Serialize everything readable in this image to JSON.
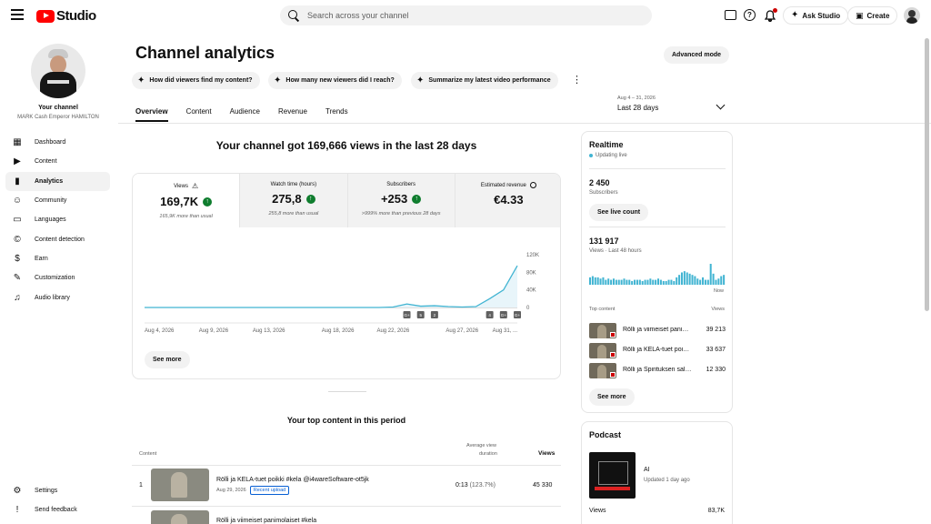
{
  "header": {
    "logo_text": "Studio",
    "search_placeholder": "Search across your channel",
    "ask_studio": "Ask Studio",
    "create": "Create",
    "icons": [
      "menu-icon",
      "messages-icon",
      "help-icon",
      "notifications-icon"
    ]
  },
  "sidebar": {
    "your_channel": "Your channel",
    "channel_name": "MARK Cash Emperor HAMILTON",
    "items": [
      {
        "label": "Dashboard",
        "icon": "dashboard-icon",
        "glyph": "▦"
      },
      {
        "label": "Content",
        "icon": "content-icon",
        "glyph": "▶"
      },
      {
        "label": "Analytics",
        "icon": "analytics-icon",
        "glyph": "▮",
        "active": true
      },
      {
        "label": "Community",
        "icon": "community-icon",
        "glyph": "☺"
      },
      {
        "label": "Languages",
        "icon": "languages-icon",
        "glyph": "▭"
      },
      {
        "label": "Content detection",
        "icon": "copyright-icon",
        "glyph": "©"
      },
      {
        "label": "Earn",
        "icon": "earn-icon",
        "glyph": "$"
      },
      {
        "label": "Customization",
        "icon": "customization-icon",
        "glyph": "✎"
      },
      {
        "label": "Audio library",
        "icon": "audio-library-icon",
        "glyph": "♫"
      }
    ],
    "bottom": [
      {
        "label": "Settings",
        "icon": "settings-icon",
        "glyph": "⚙"
      },
      {
        "label": "Send feedback",
        "icon": "feedback-icon",
        "glyph": "!"
      }
    ]
  },
  "main": {
    "title": "Channel analytics",
    "advanced_mode": "Advanced mode",
    "chips": [
      "How did viewers find my content?",
      "How many new viewers did I reach?",
      "Summarize my latest video performance"
    ],
    "tabs": [
      "Overview",
      "Content",
      "Audience",
      "Revenue",
      "Trends"
    ],
    "active_tab": "Overview",
    "date_range_sub": "Aug 4 – 31, 2026",
    "date_range": "Last 28 days",
    "headline": "Your channel got 169,666 views in the last 28 days",
    "metrics": [
      {
        "label": "Views",
        "value": "169,7K",
        "sub": "165,9K more than usual",
        "up": true,
        "icon": "warning-icon"
      },
      {
        "label": "Watch time (hours)",
        "value": "275,8",
        "sub": "255,8 more than usual",
        "up": true
      },
      {
        "label": "Subscribers",
        "value": "+253",
        "sub": ">999% more than previous 28 days",
        "up": true
      },
      {
        "label": "Estimated revenue",
        "value": "€4.33",
        "sub": "",
        "up": false,
        "icon": "clock-icon"
      }
    ],
    "see_more": "See more",
    "top_content_title": "Your top content in this period",
    "table_headers": {
      "content": "Content",
      "avg_duration_1": "Average view",
      "avg_duration_2": "duration",
      "views": "Views"
    },
    "rows": [
      {
        "num": "1",
        "title": "Rölli ja KELA-tuet poikki #kela @i4wareSoftware-ot5jk",
        "date": "Aug 29, 2026",
        "badge": "Recent upload",
        "duration": "0:13",
        "pct": "(123.7%)",
        "views": "45 330"
      },
      {
        "num": "",
        "title": "Rölli ja viimeiset panimolaiset #kela",
        "date": "",
        "badge": "",
        "duration": "",
        "pct": "",
        "views": ""
      }
    ]
  },
  "realtime": {
    "title": "Realtime",
    "updating": "Updating live",
    "subscribers": "2 450",
    "subscribers_label": "Subscribers",
    "see_live_count": "See live count",
    "views": "131 917",
    "views_label": "Views · Last 48 hours",
    "now": "Now",
    "bars": [
      6,
      7,
      6,
      6,
      5,
      6,
      4,
      5,
      4,
      5,
      4,
      4,
      4,
      5,
      4,
      4,
      3,
      4,
      4,
      4,
      3,
      4,
      4,
      5,
      4,
      4,
      5,
      4,
      3,
      3,
      4,
      4,
      3,
      6,
      8,
      10,
      11,
      10,
      9,
      8,
      7,
      5,
      4,
      6,
      4,
      4,
      17,
      9,
      4,
      5,
      7,
      8
    ],
    "top_content_label": "Top content",
    "top_views_label": "Views",
    "top_items": [
      {
        "title": "Rölli ja viimeiset panimolaiset #kela",
        "views": "39 213"
      },
      {
        "title": "Rölli ja KELA-tuet poikki #kela",
        "views": "33 637"
      },
      {
        "title": "Rölli ja Spirituksen salaisuus",
        "views": "12 330"
      }
    ],
    "see_more": "See more"
  },
  "podcast": {
    "title": "Podcast",
    "name": "AI",
    "updated": "Updated 1 day ago",
    "views_label": "Views",
    "views": "83,7K"
  },
  "chart_data": {
    "type": "line",
    "title": "",
    "xlabel": "",
    "ylabel": "",
    "x_tick_labels": [
      "Aug 4, 2026",
      "Aug 9, 2026",
      "Aug 13, 2026",
      "Aug 18, 2026",
      "Aug 22, 2026",
      "Aug 27, 2026",
      "Aug 31, ..."
    ],
    "y_tick_labels": [
      "120K",
      "80K",
      "40K",
      "0"
    ],
    "ylim": [
      0,
      120000
    ],
    "x": [
      "Aug 4",
      "Aug 5",
      "Aug 6",
      "Aug 7",
      "Aug 8",
      "Aug 9",
      "Aug 10",
      "Aug 11",
      "Aug 12",
      "Aug 13",
      "Aug 14",
      "Aug 15",
      "Aug 16",
      "Aug 17",
      "Aug 18",
      "Aug 19",
      "Aug 20",
      "Aug 21",
      "Aug 22",
      "Aug 23",
      "Aug 24",
      "Aug 25",
      "Aug 26",
      "Aug 27",
      "Aug 28",
      "Aug 29",
      "Aug 30",
      "Aug 31"
    ],
    "series": [
      {
        "values": [
          0,
          0,
          0,
          0,
          0,
          0,
          0,
          0,
          0,
          0,
          0,
          0,
          0,
          0,
          0,
          0,
          0,
          0,
          1000,
          8000,
          3000,
          4000,
          2000,
          1000,
          2000,
          20000,
          40000,
          95000
        ]
      }
    ],
    "event_markers": [
      {
        "x": "Aug 23",
        "label": "G+"
      },
      {
        "x": "Aug 24",
        "label": "5"
      },
      {
        "x": "Aug 25",
        "label": "2"
      },
      {
        "x": "Aug 29",
        "label": "4"
      },
      {
        "x": "Aug 30",
        "label": "G+"
      },
      {
        "x": "Aug 31",
        "label": "G+"
      }
    ],
    "colors": {
      "line": "#41b4d2",
      "fill": "#e8f5fa",
      "grid": "#e5e5e5",
      "marker": "#606060"
    }
  }
}
